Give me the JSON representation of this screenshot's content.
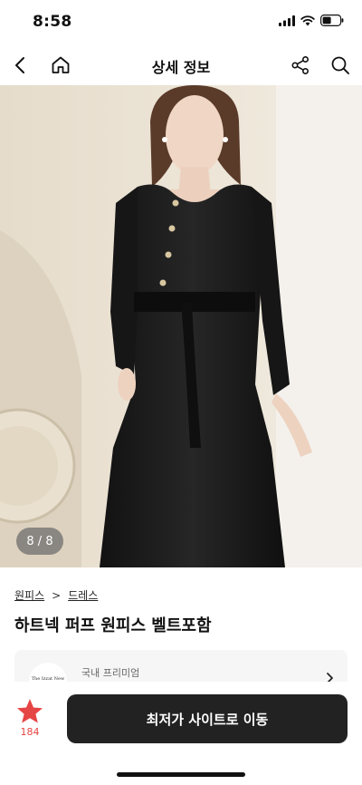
{
  "status_bar": {
    "time": "8:58"
  },
  "nav": {
    "title": "상세 정보",
    "icons": [
      "chevron-left-icon",
      "home-icon",
      "share-icon",
      "search-icon"
    ]
  },
  "gallery": {
    "counter": "8 / 8",
    "current": 8,
    "total": 8
  },
  "breadcrumb": {
    "category": "원피스",
    "separator": ">",
    "subcategory": "드레스"
  },
  "product": {
    "title": "하트넥 퍼프 원피스 벨트포함"
  },
  "seller": {
    "logo_text": "The Izzat New Yor",
    "label": "국내 프리미엄"
  },
  "bottom_bar": {
    "favorite_count": "184",
    "cta_label": "최저가 사이트로 이동",
    "favorite_color": "#e64545",
    "cta_color": "#222222"
  }
}
